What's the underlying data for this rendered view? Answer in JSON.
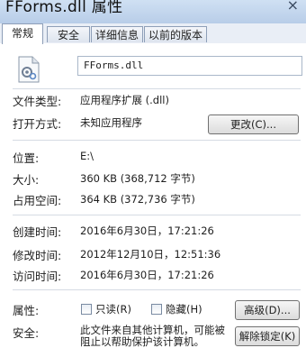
{
  "window": {
    "title": "FForms.dll 属性",
    "close_glyph": "×"
  },
  "tabs": [
    {
      "label": "常规",
      "active": true
    },
    {
      "label": "安全"
    },
    {
      "label": "详细信息"
    },
    {
      "label": "以前的版本"
    }
  ],
  "general": {
    "icon": "dll-file-icon",
    "file_name": "FForms.dll",
    "file_type_label": "文件类型:",
    "file_type_value": "应用程序扩展 (.dll)",
    "opens_with_label": "打开方式:",
    "opens_with_value": "未知应用程序",
    "change_button": "更改(C)...",
    "location_label": "位置:",
    "location_value": "E:\\",
    "size_label": "大小:",
    "size_value": "360 KB (368,712 字节)",
    "size_on_disk_label": "占用空间:",
    "size_on_disk_value": "364 KB (372,736 字节)",
    "created_label": "创建时间:",
    "created_value": "2016年6月30日，17:21:26",
    "modified_label": "修改时间:",
    "modified_value": "2012年12月10日，12:51:36",
    "accessed_label": "访问时间:",
    "accessed_value": "2016年6月30日，17:21:26",
    "attributes_label": "属性:",
    "readonly_label": "只读(R)",
    "hidden_label": "隐藏(H)",
    "advanced_button": "高级(D)...",
    "security_label": "安全:",
    "security_text": "此文件来自其他计算机，可能被阻止以帮助保护该计算机。",
    "unblock_button": "解除锁定(K)"
  }
}
